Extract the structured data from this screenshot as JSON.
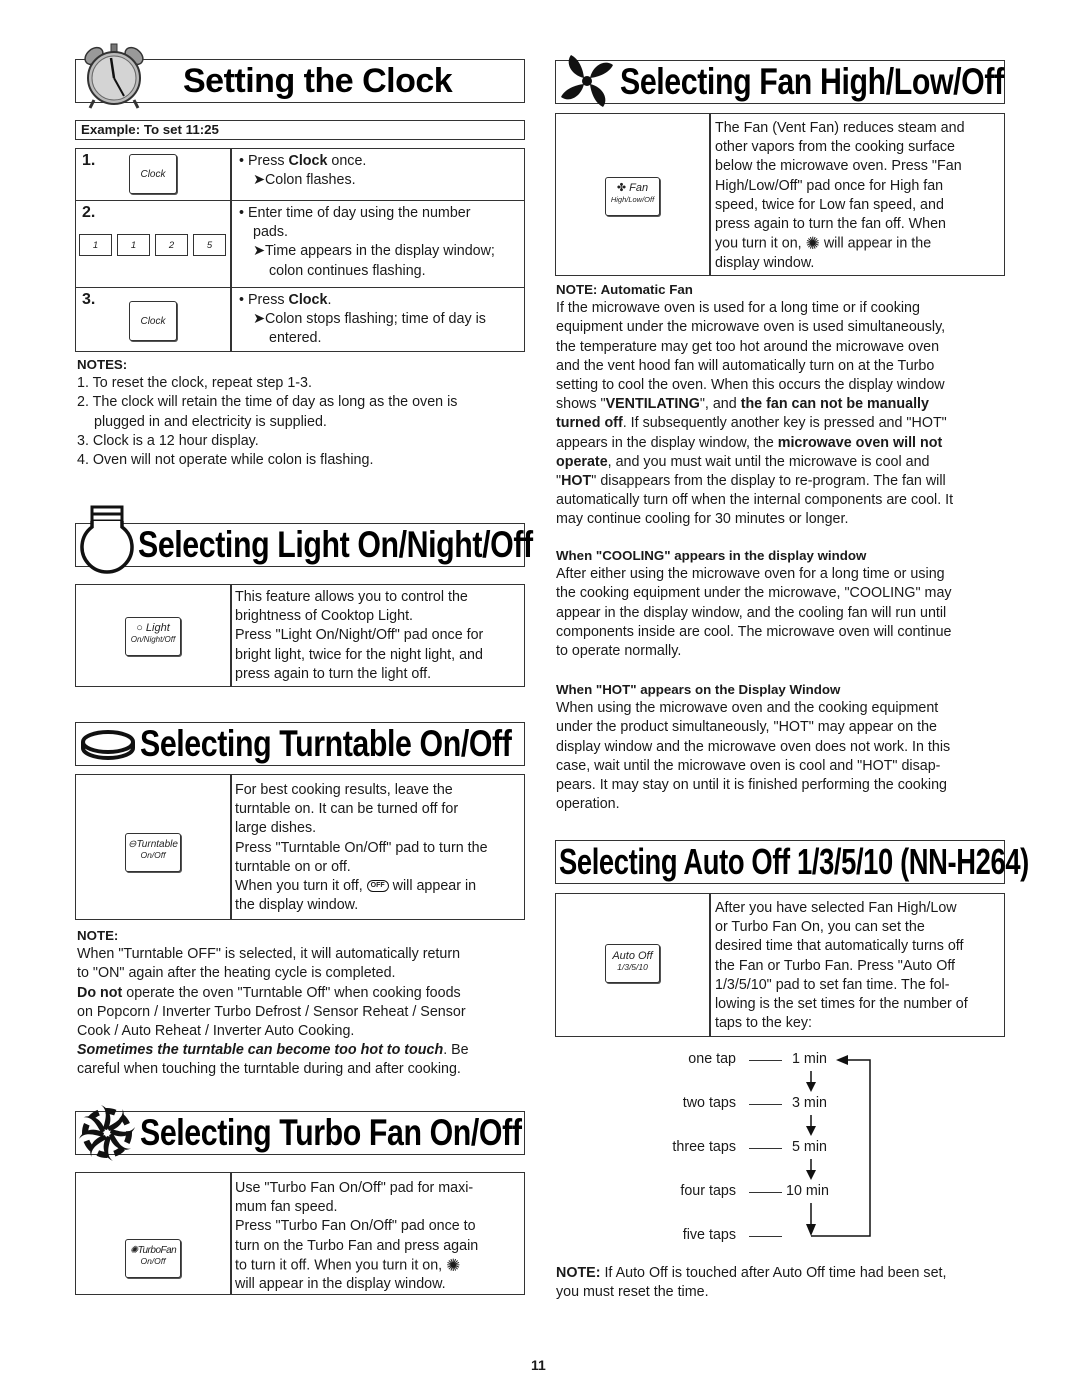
{
  "page_number": "11",
  "clock": {
    "title": "Setting the Clock",
    "example": "Example: To set 11:25",
    "steps": [
      {
        "num": "1.",
        "pads": [
          "Clock"
        ],
        "lines": [
          "• Press ",
          "Clock",
          " once.",
          "➤Colon flashes."
        ]
      },
      {
        "num": "2.",
        "pads": [
          "1",
          "1",
          "2",
          "5"
        ],
        "lines": [
          "• Enter time of day using the number",
          "pads.",
          "➤Time appears in the display window;",
          "colon continues flashing."
        ]
      },
      {
        "num": "3.",
        "pads": [
          "Clock"
        ],
        "lines": [
          "• Press ",
          "Clock",
          ".",
          "➤Colon stops flashing; time of day is",
          "entered."
        ]
      }
    ],
    "notes_title": "NOTES:",
    "notes": [
      "1. To reset the clock, repeat step 1-3.",
      "2. The clock will retain the time of day as long as the oven is",
      "plugged in and electricity is supplied.",
      "3. Clock is a 12 hour display.",
      "4. Oven will not operate while colon is flashing."
    ]
  },
  "light": {
    "title": "Selecting Light On/Night/Off",
    "pad_top": "Light",
    "pad_bottom": "On/Night/Off",
    "lines": [
      "This feature allows you to control the",
      "brightness of Cooktop Light.",
      "Press \"Light On/Night/Off\" pad once for",
      "bright light, twice for the night light, and",
      "press again to turn the light off."
    ]
  },
  "turntable": {
    "title": "Selecting Turntable On/Off",
    "pad_top": "Turntable",
    "pad_bottom": "On/Off",
    "lines": [
      "For best cooking results, leave the",
      "turntable on. It can be turned off for",
      "large dishes.",
      "Press \"Turntable On/Off\" pad to turn the",
      "turntable on or off.",
      "When you turn it off,",
      "will appear in",
      "the display window."
    ],
    "off_icon_text": "OFF",
    "note_title": "NOTE:",
    "note_lines": [
      "When \"Turntable OFF\" is selected, it will automatically return",
      "to \"ON\" again after the heating cycle is completed."
    ],
    "do_not_bold": "Do not",
    "do_not_rest": " operate the oven \"Turntable Off\" when cooking foods",
    "do_not_lines": [
      "on Popcorn / Inverter Turbo Defrost / Sensor Reheat / Sensor",
      "Cook / Auto Reheat / Inverter Auto Cooking."
    ],
    "warning_bold": "Sometimes the turntable can become too hot to touch",
    "warning_rest": ". Be",
    "warning_line2": "careful when touching the turntable during and after cooking."
  },
  "turbo": {
    "title": "Selecting Turbo Fan On/Off",
    "pad_top": "TurboFan",
    "pad_bottom": "On/Off",
    "lines": [
      "Use \"Turbo Fan On/Off\" pad for maxi-",
      "mum fan speed.",
      "Press \"Turbo Fan On/Off\" pad once to",
      "turn on the Turbo Fan and press again",
      "to turn it off. When you turn it on,",
      "will appear in the display window."
    ]
  },
  "fan": {
    "title": "Selecting Fan High/Low/Off",
    "pad_top": "Fan",
    "pad_bottom": "High/Low/Off",
    "lines": [
      "The Fan (Vent Fan) reduces steam and",
      "other vapors from the cooking surface",
      "below the microwave oven. Press \"Fan",
      "High/Low/Off\" pad once for High fan",
      "speed, twice for Low fan speed, and",
      "press again to turn the fan off. When",
      "you turn it on,",
      "will appear in the",
      "display window."
    ],
    "auto_title": "NOTE: Automatic Fan",
    "auto_lines": [
      [
        "If the microwave oven is used for a long time or if cooking"
      ],
      [
        "equipment under the microwave oven is used simultaneously,"
      ],
      [
        "the temperature may get too hot around the microwave oven"
      ],
      [
        "and the vent hood fan will automatically turn on at the Turbo"
      ],
      [
        "setting to cool the oven. When this occurs the display window"
      ]
    ],
    "auto_l6": [
      "shows \"",
      "VENTILATING",
      "\", and ",
      "the fan can not be manually"
    ],
    "auto_l7": [
      "turned off",
      ". If subsequently another key is pressed and \"HOT\""
    ],
    "auto_l8": [
      "appears in the display window, the ",
      "microwave oven will not"
    ],
    "auto_l9": [
      "operate",
      ", and you must wait until the microwave is cool and"
    ],
    "auto_l10": [
      "\"",
      "HOT",
      "\" disappears from the display to re-program. The fan will"
    ],
    "auto_l11": "automatically turn off when the internal components are cool. It",
    "auto_l12": "may continue cooling for 30 minutes or longer.",
    "cooling_title": "When \"COOLING\" appears in the display window",
    "cooling_lines": [
      "After either using the microwave oven for a long time or using",
      "the cooking equipment under the microwave, \"COOLING\" may",
      "appear in the display window, and the cooling fan will run until",
      "components inside are cool. The microwave oven will continue",
      "to operate normally."
    ],
    "hot_title": "When \"HOT\" appears on the Display Window",
    "hot_lines": [
      "When using the microwave oven and the cooking equipment",
      "under the product simultaneously, \"HOT\" may appear on the",
      "display window and the microwave oven does not work. In this",
      "case, wait until the microwave oven is cool and \"HOT\" disap-",
      "pears. It may stay on until it is finished performing the cooking",
      "operation."
    ]
  },
  "autooff": {
    "title": "Selecting Auto Off 1/3/5/10 (NN-H264)",
    "pad_top": "Auto Off",
    "pad_bottom": "1/3/5/10",
    "lines": [
      "After you have selected Fan High/Low",
      "or Turbo Fan On, you can set the",
      "desired time that automatically turns off",
      "the Fan or Turbo Fan. Press \"Auto Off",
      "1/3/5/10\" pad to set fan time. The fol-",
      "lowing is the set times for the number of",
      "taps to the key:"
    ],
    "taps": [
      {
        "label": "one tap",
        "value": "1 min"
      },
      {
        "label": "two taps",
        "value": "3 min"
      },
      {
        "label": "three taps",
        "value": "5 min"
      },
      {
        "label": "four taps",
        "value": "10 min"
      },
      {
        "label": "five taps",
        "value": ""
      }
    ],
    "note_bold": "NOTE:",
    "note_rest": " If Auto Off is touched after Auto Off time had been set,",
    "note_line2": "you must reset the time."
  }
}
